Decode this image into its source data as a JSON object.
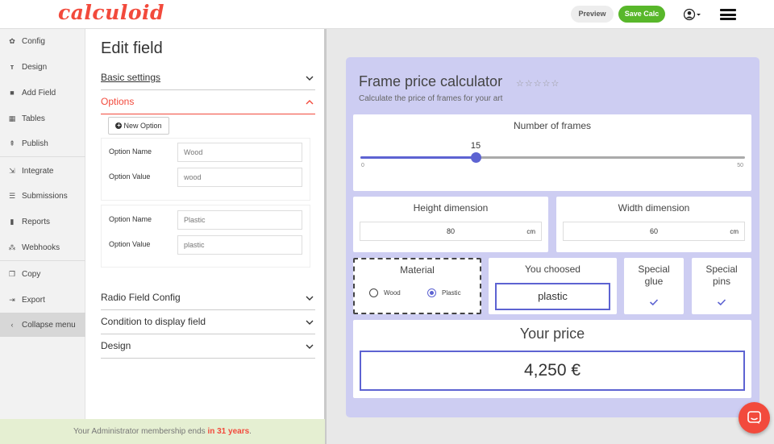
{
  "app": {
    "logo": "calculoid"
  },
  "topbar": {
    "preview_label": "Preview",
    "save_label": "Save Calc"
  },
  "sidebar": {
    "items": [
      {
        "label": "Config",
        "icon": "gear-icon"
      },
      {
        "label": "Design",
        "icon": "text-format-icon"
      },
      {
        "label": "Add Field",
        "icon": "add-square-icon"
      },
      {
        "label": "Tables",
        "icon": "table-icon"
      },
      {
        "label": "Publish",
        "icon": "upload-icon"
      },
      {
        "label": "Integrate",
        "icon": "integrate-icon"
      },
      {
        "label": "Submissions",
        "icon": "list-icon"
      },
      {
        "label": "Reports",
        "icon": "bar-chart-icon"
      },
      {
        "label": "Webhooks",
        "icon": "webhook-icon"
      },
      {
        "label": "Copy",
        "icon": "copy-icon"
      },
      {
        "label": "Export",
        "icon": "export-icon"
      },
      {
        "label": "Collapse menu",
        "icon": "chevron-left-icon"
      }
    ]
  },
  "edit_panel": {
    "title": "Edit field",
    "sections": {
      "basic": "Basic settings",
      "options": "Options",
      "radio": "Radio Field Config",
      "condition": "Condition to display field",
      "design": "Design"
    },
    "new_option_label": "New Option",
    "option_name_label": "Option Name",
    "option_value_label": "Option Value",
    "options": [
      {
        "name": "Wood",
        "value": "wood"
      },
      {
        "name": "Plastic",
        "value": "plastic"
      }
    ]
  },
  "footer": {
    "text_before": "Your Administrator membership ends ",
    "highlight": "in 31 years",
    "text_after": "."
  },
  "calculator": {
    "title": "Frame price calculator",
    "stars": "☆☆☆☆☆",
    "subtitle": "Calculate the price of frames for your art",
    "frames": {
      "label": "Number of frames",
      "value": "15",
      "min": "0",
      "max": "50",
      "fraction": 0.3
    },
    "height": {
      "label": "Height dimension",
      "value": "80",
      "unit": "cm"
    },
    "width": {
      "label": "Width dimension",
      "value": "60",
      "unit": "cm"
    },
    "material": {
      "label": "Material",
      "options": [
        "Wood",
        "Plastic"
      ],
      "selected": "Plastic"
    },
    "chosen": {
      "label": "You choosed",
      "value": "plastic"
    },
    "glue": {
      "label_line1": "Special",
      "label_line2": "glue"
    },
    "pins": {
      "label_line1": "Special",
      "label_line2": "pins"
    },
    "price": {
      "label": "Your price",
      "value": "4,250 €"
    }
  },
  "colors": {
    "brand": "#f24a3c",
    "save_green": "#58b72a",
    "accent": "#5d63d2",
    "calc_bg": "#cdcdf2",
    "footer_bg": "#e5efd2"
  }
}
